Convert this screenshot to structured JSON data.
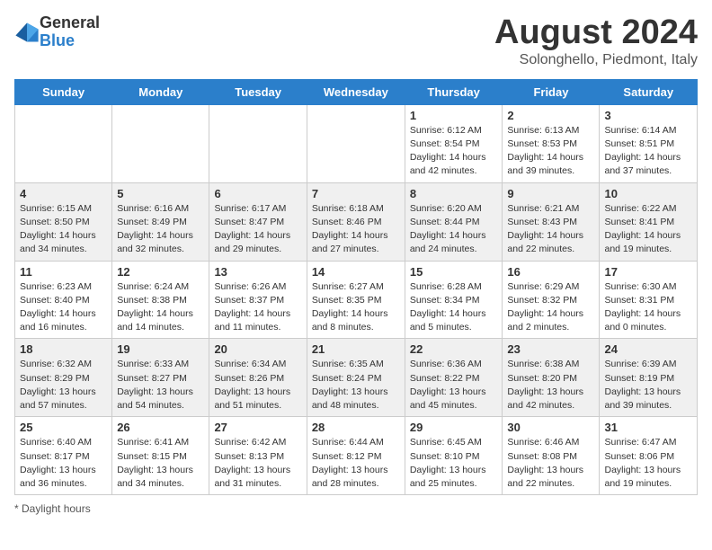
{
  "header": {
    "logo_general": "General",
    "logo_blue": "Blue",
    "month_year": "August 2024",
    "location": "Solonghello, Piedmont, Italy"
  },
  "days_of_week": [
    "Sunday",
    "Monday",
    "Tuesday",
    "Wednesday",
    "Thursday",
    "Friday",
    "Saturday"
  ],
  "footer": {
    "note": "Daylight hours"
  },
  "weeks": [
    [
      {
        "day": "",
        "info": ""
      },
      {
        "day": "",
        "info": ""
      },
      {
        "day": "",
        "info": ""
      },
      {
        "day": "",
        "info": ""
      },
      {
        "day": "1",
        "info": "Sunrise: 6:12 AM\nSunset: 8:54 PM\nDaylight: 14 hours and 42 minutes."
      },
      {
        "day": "2",
        "info": "Sunrise: 6:13 AM\nSunset: 8:53 PM\nDaylight: 14 hours and 39 minutes."
      },
      {
        "day": "3",
        "info": "Sunrise: 6:14 AM\nSunset: 8:51 PM\nDaylight: 14 hours and 37 minutes."
      }
    ],
    [
      {
        "day": "4",
        "info": "Sunrise: 6:15 AM\nSunset: 8:50 PM\nDaylight: 14 hours and 34 minutes."
      },
      {
        "day": "5",
        "info": "Sunrise: 6:16 AM\nSunset: 8:49 PM\nDaylight: 14 hours and 32 minutes."
      },
      {
        "day": "6",
        "info": "Sunrise: 6:17 AM\nSunset: 8:47 PM\nDaylight: 14 hours and 29 minutes."
      },
      {
        "day": "7",
        "info": "Sunrise: 6:18 AM\nSunset: 8:46 PM\nDaylight: 14 hours and 27 minutes."
      },
      {
        "day": "8",
        "info": "Sunrise: 6:20 AM\nSunset: 8:44 PM\nDaylight: 14 hours and 24 minutes."
      },
      {
        "day": "9",
        "info": "Sunrise: 6:21 AM\nSunset: 8:43 PM\nDaylight: 14 hours and 22 minutes."
      },
      {
        "day": "10",
        "info": "Sunrise: 6:22 AM\nSunset: 8:41 PM\nDaylight: 14 hours and 19 minutes."
      }
    ],
    [
      {
        "day": "11",
        "info": "Sunrise: 6:23 AM\nSunset: 8:40 PM\nDaylight: 14 hours and 16 minutes."
      },
      {
        "day": "12",
        "info": "Sunrise: 6:24 AM\nSunset: 8:38 PM\nDaylight: 14 hours and 14 minutes."
      },
      {
        "day": "13",
        "info": "Sunrise: 6:26 AM\nSunset: 8:37 PM\nDaylight: 14 hours and 11 minutes."
      },
      {
        "day": "14",
        "info": "Sunrise: 6:27 AM\nSunset: 8:35 PM\nDaylight: 14 hours and 8 minutes."
      },
      {
        "day": "15",
        "info": "Sunrise: 6:28 AM\nSunset: 8:34 PM\nDaylight: 14 hours and 5 minutes."
      },
      {
        "day": "16",
        "info": "Sunrise: 6:29 AM\nSunset: 8:32 PM\nDaylight: 14 hours and 2 minutes."
      },
      {
        "day": "17",
        "info": "Sunrise: 6:30 AM\nSunset: 8:31 PM\nDaylight: 14 hours and 0 minutes."
      }
    ],
    [
      {
        "day": "18",
        "info": "Sunrise: 6:32 AM\nSunset: 8:29 PM\nDaylight: 13 hours and 57 minutes."
      },
      {
        "day": "19",
        "info": "Sunrise: 6:33 AM\nSunset: 8:27 PM\nDaylight: 13 hours and 54 minutes."
      },
      {
        "day": "20",
        "info": "Sunrise: 6:34 AM\nSunset: 8:26 PM\nDaylight: 13 hours and 51 minutes."
      },
      {
        "day": "21",
        "info": "Sunrise: 6:35 AM\nSunset: 8:24 PM\nDaylight: 13 hours and 48 minutes."
      },
      {
        "day": "22",
        "info": "Sunrise: 6:36 AM\nSunset: 8:22 PM\nDaylight: 13 hours and 45 minutes."
      },
      {
        "day": "23",
        "info": "Sunrise: 6:38 AM\nSunset: 8:20 PM\nDaylight: 13 hours and 42 minutes."
      },
      {
        "day": "24",
        "info": "Sunrise: 6:39 AM\nSunset: 8:19 PM\nDaylight: 13 hours and 39 minutes."
      }
    ],
    [
      {
        "day": "25",
        "info": "Sunrise: 6:40 AM\nSunset: 8:17 PM\nDaylight: 13 hours and 36 minutes."
      },
      {
        "day": "26",
        "info": "Sunrise: 6:41 AM\nSunset: 8:15 PM\nDaylight: 13 hours and 34 minutes."
      },
      {
        "day": "27",
        "info": "Sunrise: 6:42 AM\nSunset: 8:13 PM\nDaylight: 13 hours and 31 minutes."
      },
      {
        "day": "28",
        "info": "Sunrise: 6:44 AM\nSunset: 8:12 PM\nDaylight: 13 hours and 28 minutes."
      },
      {
        "day": "29",
        "info": "Sunrise: 6:45 AM\nSunset: 8:10 PM\nDaylight: 13 hours and 25 minutes."
      },
      {
        "day": "30",
        "info": "Sunrise: 6:46 AM\nSunset: 8:08 PM\nDaylight: 13 hours and 22 minutes."
      },
      {
        "day": "31",
        "info": "Sunrise: 6:47 AM\nSunset: 8:06 PM\nDaylight: 13 hours and 19 minutes."
      }
    ]
  ]
}
